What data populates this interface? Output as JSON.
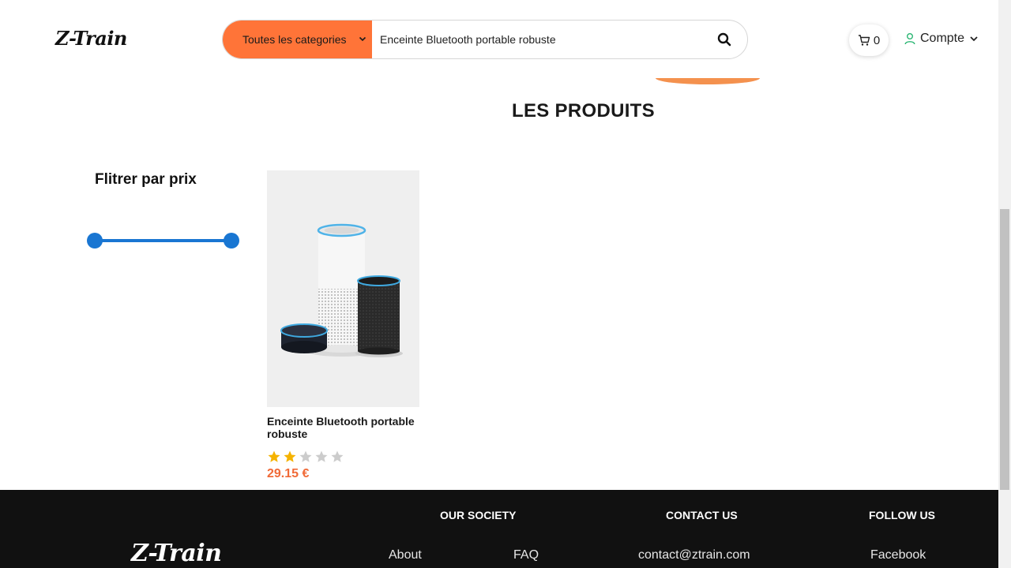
{
  "header": {
    "logo": "Z-Train",
    "category_select": "Toutes les categories",
    "search_value": "Enceinte Bluetooth portable robuste",
    "cart_count": "0",
    "account_label": "Compte"
  },
  "main": {
    "heading": "LES PRODUITS",
    "filter_title": "Flitrer par prix",
    "product": {
      "name": "Enceinte Bluetooth portable robuste",
      "rating": 2,
      "rating_max": 5,
      "price": "29.15 €"
    }
  },
  "footer": {
    "logo": "Z-Train",
    "headings": {
      "society": "OUR SOCIETY",
      "contact": "CONTACT US",
      "follow": "FOLLOW US"
    },
    "links": {
      "about": "About",
      "faq": "FAQ",
      "email": "contact@ztrain.com",
      "facebook": "Facebook"
    }
  },
  "colors": {
    "accent": "#ff7438",
    "price": "#f06a37",
    "slider": "#1976d2",
    "star_filled": "#f5b301",
    "star_empty": "#cccccc",
    "footer_bg": "#111111"
  },
  "icons": [
    "chevron-down-icon",
    "search-icon",
    "cart-icon",
    "user-icon"
  ]
}
